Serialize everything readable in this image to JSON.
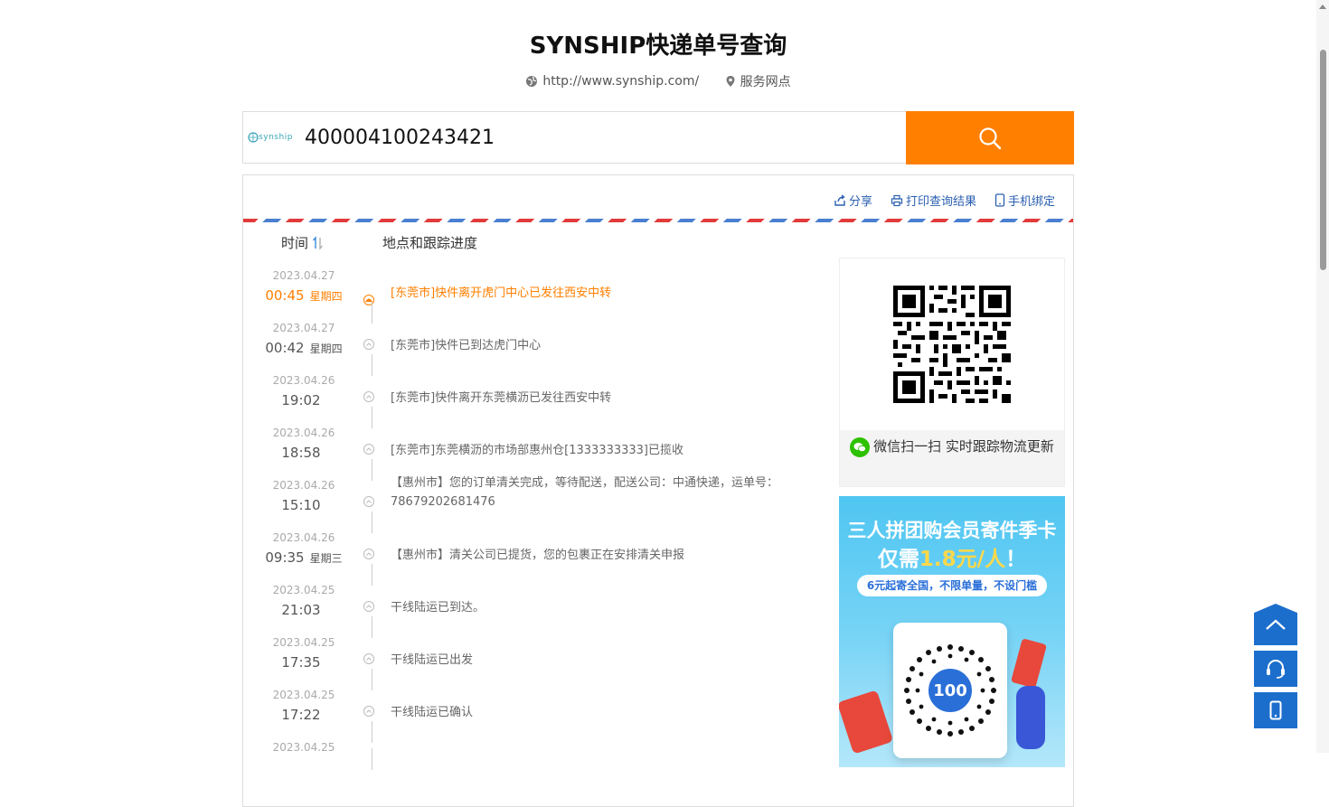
{
  "header": {
    "title": "SYNSHIP快递单号查询",
    "website": "http://www.synship.com/",
    "service_points": "服务网点"
  },
  "search": {
    "brand_logo": "synship",
    "tracking_number": "400004100243421"
  },
  "toolbar": {
    "share": "分享",
    "print": "打印查询结果",
    "bind_phone": "手机绑定"
  },
  "columns": {
    "time": "时间",
    "location": "地点和跟踪进度"
  },
  "events": [
    {
      "date": "2023.04.27",
      "time": "00:45",
      "weekday": "星期四",
      "context": "[东莞市]快件离开虎门中心已发往西安中转"
    },
    {
      "date": "2023.04.27",
      "time": "00:42",
      "weekday": "星期四",
      "context": "[东莞市]快件已到达虎门中心"
    },
    {
      "date": "2023.04.26",
      "time": "19:02",
      "weekday": "",
      "context": "[东莞市]快件离开东莞横沥已发往西安中转"
    },
    {
      "date": "2023.04.26",
      "time": "18:58",
      "weekday": "",
      "context": "[东莞市]东莞横沥的市场部惠州仓[1333333333]已揽收"
    },
    {
      "date": "2023.04.26",
      "time": "15:10",
      "weekday": "",
      "context": "【惠州市】您的订单清关完成，等待配送，配送公司：中通快递，运单号：78679202681476"
    },
    {
      "date": "2023.04.26",
      "time": "09:35",
      "weekday": "星期三",
      "context": "【惠州市】清关公司已提货，您的包裹正在安排清关申报"
    },
    {
      "date": "2023.04.25",
      "time": "21:03",
      "weekday": "",
      "context": "干线陆运已到达。"
    },
    {
      "date": "2023.04.25",
      "time": "17:35",
      "weekday": "",
      "context": "干线陆运已出发"
    },
    {
      "date": "2023.04.25",
      "time": "17:22",
      "weekday": "",
      "context": "干线陆运已确认"
    },
    {
      "date": "2023.04.25",
      "time": "",
      "weekday": "",
      "context": ""
    }
  ],
  "qr": {
    "text": "微信扫一扫 实时跟踪物流更新"
  },
  "promo": {
    "line1": "三人拼团购会员寄件季卡",
    "line2_prefix": "仅需",
    "line2_price": "1.8元/人",
    "line2_suffix": "！",
    "pill": "6元起寄全国，不限单量，不设门槛",
    "logo": "100"
  },
  "colors": {
    "accent": "#ff7f00",
    "link": "#2a5fb0",
    "float_button": "#1c6ecc"
  }
}
